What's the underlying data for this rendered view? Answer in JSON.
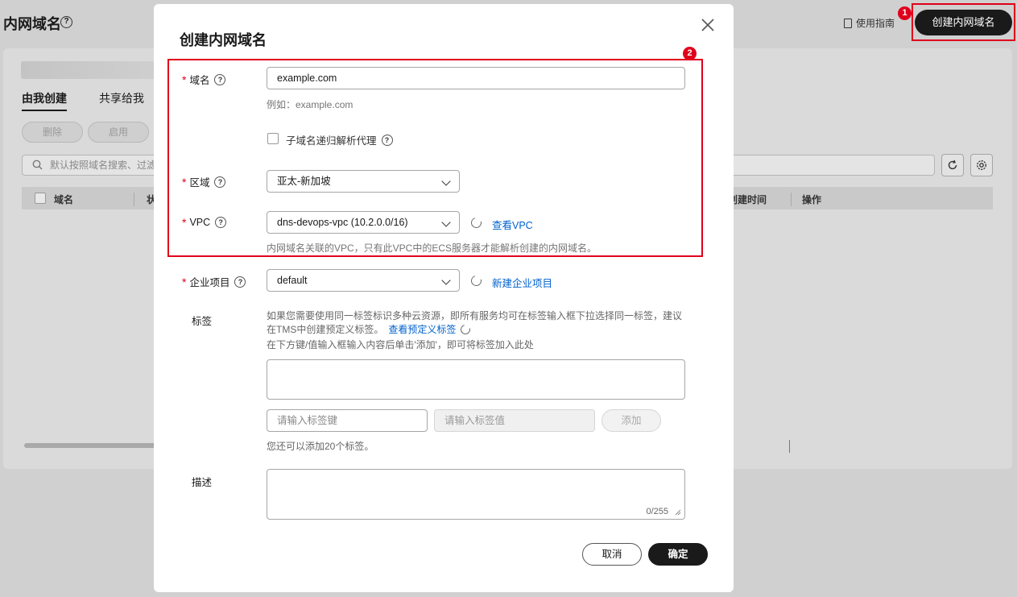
{
  "background": {
    "page_title": "内网域名",
    "help_icon": "?",
    "guide_label": "使用指南",
    "create_button": "创建内网域名",
    "markers": [
      "1",
      "2"
    ],
    "tabs": [
      "由我创建",
      "共享给我"
    ],
    "buttons": [
      "删除",
      "启用"
    ],
    "search_placeholder": "默认按照域名搜索、过滤",
    "table_headers": [
      "域名",
      "状",
      "创建时间",
      "操作"
    ]
  },
  "modal": {
    "title": "创建内网域名",
    "domain": {
      "label": "域名",
      "value": "example.com",
      "hint": "例如：example.com"
    },
    "recursive_proxy": {
      "label": "子域名递归解析代理",
      "checked": false
    },
    "region": {
      "label": "区域",
      "value": "亚太-新加坡"
    },
    "vpc": {
      "label": "VPC",
      "value": "dns-devops-vpc (10.2.0.0/16)",
      "link": "查看VPC",
      "hint": "内网域名关联的VPC，只有此VPC中的ECS服务器才能解析创建的内网域名。"
    },
    "enterprise_project": {
      "label": "企业项目",
      "value": "default",
      "link": "新建企业项目"
    },
    "tags": {
      "label": "标签",
      "desc_line1": "如果您需要使用同一标签标识多种云资源，即所有服务均可在标签输入框下拉选择同一标签，建议",
      "desc_line2": "在TMS中创建预定义标签。",
      "predefined_link": "查看预定义标签",
      "desc_line3": "在下方键/值输入框输入内容后单击'添加'，即可将标签加入此处",
      "key_placeholder": "请输入标签键",
      "value_placeholder": "请输入标签值",
      "add_button": "添加",
      "remaining": "您还可以添加20个标签。"
    },
    "description": {
      "label": "描述",
      "counter": "0/255"
    },
    "cancel_button": "取消",
    "confirm_button": "确定"
  },
  "colors": {
    "highlight": "#e0001b",
    "link": "#0061cc",
    "primary_button": "#1a1a1a"
  }
}
